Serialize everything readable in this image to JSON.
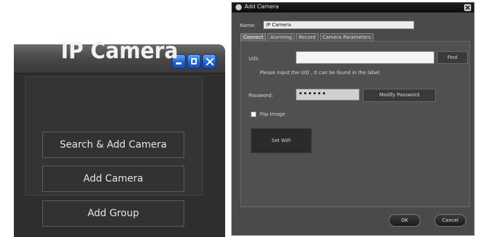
{
  "left_window": {
    "title": "IP Camera",
    "buttons": {
      "search_add": "Search & Add Camera",
      "add_camera": "Add Camera",
      "add_group": "Add Group"
    }
  },
  "dialog": {
    "title": "Add Camera",
    "name_label": "Name:",
    "name_value": "IP Camera",
    "tabs": [
      "Connect",
      "Alarming",
      "Record",
      "Camera Parameters"
    ],
    "uid_label": "UID:",
    "uid_value": "",
    "find_label": "Find",
    "uid_hint": "Please input the UID , It can be found in the label.",
    "password_label": "Password:",
    "password_value": "••••••",
    "modify_password_label": "Modify Password",
    "flip_image_label": "Flip Image",
    "flip_image_checked": false,
    "set_wifi_label": "Set WiFi",
    "ok_label": "OK",
    "cancel_label": "Cancel"
  },
  "colors": {
    "window_bg": "#2e2e2e",
    "dialog_bg": "#4a4a4a",
    "window_button_blue": "#1f5fd6"
  }
}
